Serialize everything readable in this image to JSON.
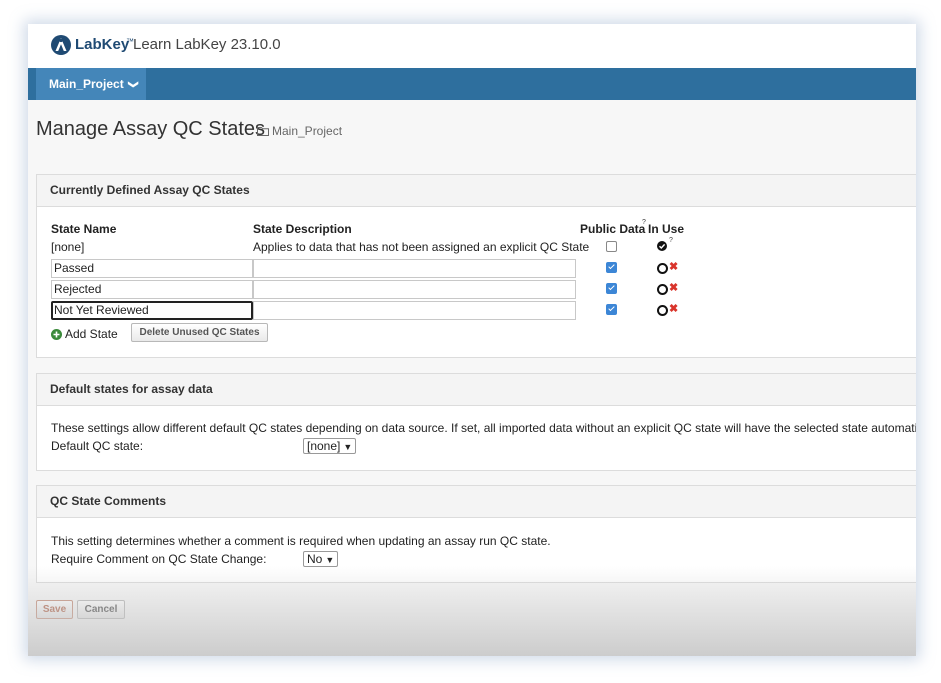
{
  "header": {
    "brand": "LabKey",
    "brand_mark": "™",
    "site_title": "Learn LabKey 23.10.0",
    "logo_icon": "labkey-logo-icon"
  },
  "nav": {
    "project_label": "Main_Project",
    "project_chevron": "❯"
  },
  "page": {
    "title": "Manage Assay QC States",
    "breadcrumb": "Main_Project",
    "breadcrumb_icon": "folder-icon"
  },
  "qc_states": {
    "heading": "Currently Defined Assay QC States",
    "columns": {
      "name": "State Name",
      "description": "State Description",
      "public": "Public Data",
      "public_help": "?",
      "in_use": "In Use"
    },
    "none_row": {
      "name": "[none]",
      "description": "Applies to data that has not been assigned an explicit QC State",
      "public": false,
      "in_use_help": "?"
    },
    "rows": [
      {
        "name": "Passed",
        "description": "",
        "public": true
      },
      {
        "name": "Rejected",
        "description": "",
        "public": true
      },
      {
        "name": "Not Yet Reviewed",
        "description": "",
        "public": true
      }
    ],
    "add_label": "Add State",
    "delete_unused_label": "Delete Unused QC States",
    "accent": "#3c86d6",
    "delete_color": "#d9342b"
  },
  "defaults": {
    "heading": "Default states for assay data",
    "description": "These settings allow different default QC states depending on data source. If set, all imported data without an explicit QC state will have the selected state automaticall",
    "label": "Default QC state:",
    "selected": "[none]"
  },
  "comments": {
    "heading": "QC State Comments",
    "description": "This setting determines whether a comment is required when updating an assay run QC state.",
    "label": "Require Comment on QC State Change:",
    "selected": "No"
  },
  "actions": {
    "save": "Save",
    "cancel": "Cancel"
  }
}
